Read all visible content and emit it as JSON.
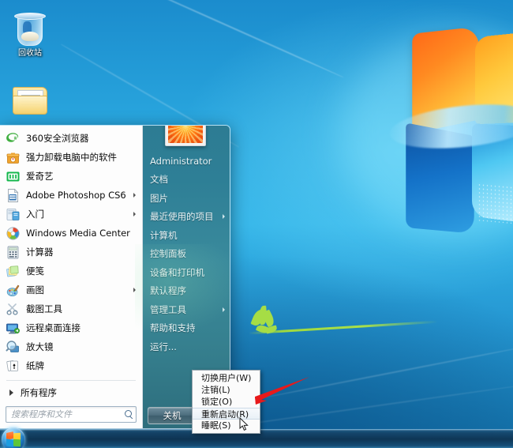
{
  "desktop": {
    "icons": [
      {
        "name": "recycle-bin",
        "label": "回收站"
      },
      {
        "name": "folder",
        "label": ""
      }
    ]
  },
  "start_menu": {
    "programs": [
      {
        "label": "360安全浏览器",
        "icon": "browser-360-icon",
        "submenu": false
      },
      {
        "label": "强力卸载电脑中的软件",
        "icon": "uninstaller-icon",
        "submenu": false
      },
      {
        "label": "爱奇艺",
        "icon": "iqiyi-icon",
        "submenu": false
      },
      {
        "label": "Adobe Photoshop CS6",
        "icon": "photoshop-icon",
        "submenu": true
      },
      {
        "label": "入门",
        "icon": "getting-started-icon",
        "submenu": true
      },
      {
        "label": "Windows Media Center",
        "icon": "media-center-icon",
        "submenu": false
      },
      {
        "label": "计算器",
        "icon": "calculator-icon",
        "submenu": false
      },
      {
        "label": "便笺",
        "icon": "sticky-notes-icon",
        "submenu": false
      },
      {
        "label": "画图",
        "icon": "paint-icon",
        "submenu": true
      },
      {
        "label": "截图工具",
        "icon": "snipping-tool-icon",
        "submenu": false
      },
      {
        "label": "远程桌面连接",
        "icon": "remote-desktop-icon",
        "submenu": false
      },
      {
        "label": "放大镜",
        "icon": "magnifier-icon",
        "submenu": false
      },
      {
        "label": "纸牌",
        "icon": "solitaire-icon",
        "submenu": false
      }
    ],
    "all_programs_label": "所有程序",
    "search": {
      "placeholder": "搜索程序和文件",
      "value": "",
      "icon": "search-icon"
    },
    "user": {
      "name": "Administrator",
      "avatar": "flower-avatar"
    },
    "right_items": [
      {
        "label": "文档",
        "submenu": false
      },
      {
        "label": "图片",
        "submenu": false
      },
      {
        "label": "最近使用的项目",
        "submenu": true
      },
      {
        "label": "计算机",
        "submenu": false
      },
      {
        "label": "控制面板",
        "submenu": false
      },
      {
        "label": "设备和打印机",
        "submenu": false
      },
      {
        "label": "默认程序",
        "submenu": false
      },
      {
        "label": "管理工具",
        "submenu": true
      },
      {
        "label": "帮助和支持",
        "submenu": false
      },
      {
        "label": "运行...",
        "submenu": false
      }
    ],
    "shutdown": {
      "label": "关机",
      "more_icon": "chevron-right-icon"
    }
  },
  "power_menu": {
    "items": [
      {
        "label": "切换用户(W)",
        "selected": false
      },
      {
        "label": "注销(L)",
        "selected": false
      },
      {
        "label": "锁定(O)",
        "selected": false
      },
      {
        "label": "重新启动(R)",
        "selected": true
      },
      {
        "label": "睡眠(S)",
        "selected": false
      }
    ]
  },
  "annotation": {
    "arrow_color": "#e8191b",
    "points_at": "重新启动(R)"
  },
  "taskbar": {
    "start_orb": "windows-start-orb"
  },
  "colors": {
    "desktop_blue": "#29a6de",
    "menu_right_teal": "#36808f",
    "menu_left_white": "#fdfdfd",
    "accent_red": "#e8191b"
  }
}
